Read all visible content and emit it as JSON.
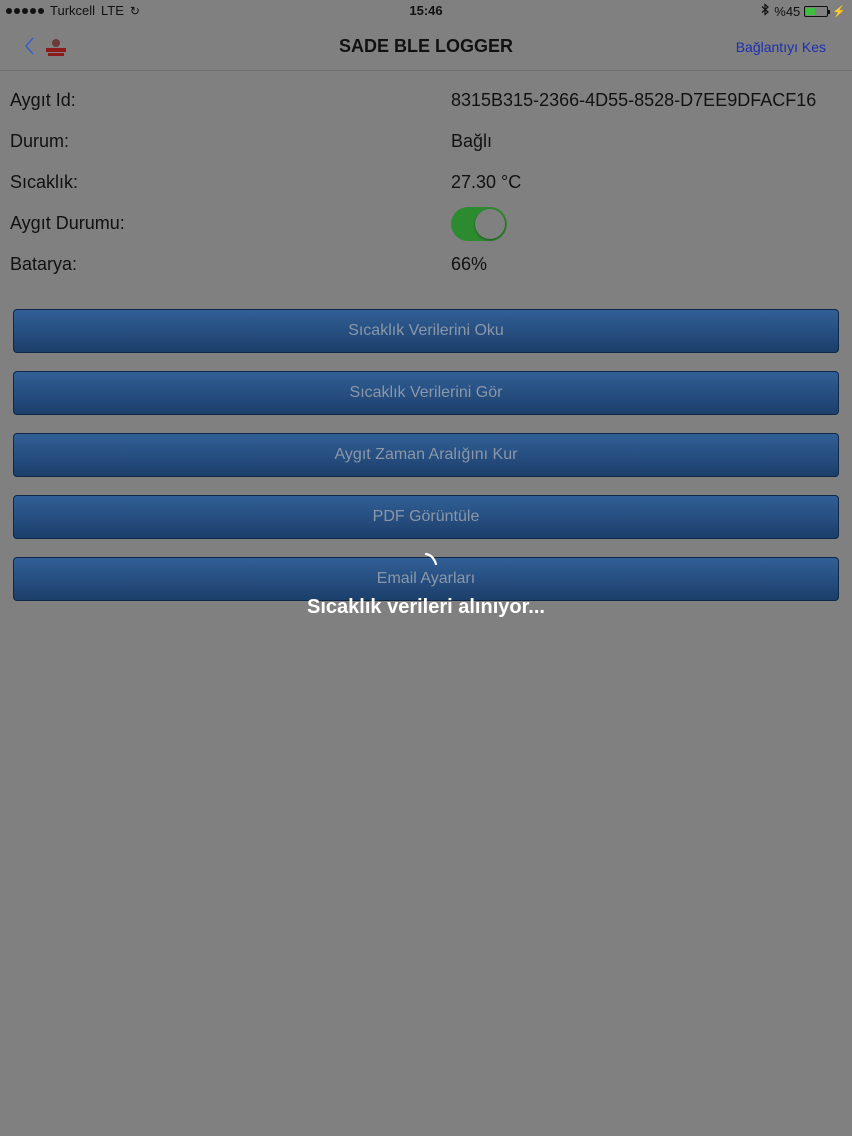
{
  "status_bar": {
    "carrier": "Turkcell",
    "network": "LTE",
    "time": "15:46",
    "battery_percent": "%45",
    "battery_level": 0.45,
    "icons": [
      "signal-dots-icon",
      "sync-icon",
      "bluetooth-icon",
      "battery-icon",
      "charging-bolt-icon"
    ]
  },
  "nav": {
    "title": "SADE BLE LOGGER",
    "back_icon": "chevron-left-icon",
    "disconnect_label": "Bağlantıyı Kes",
    "link_color": "#1b2fb0"
  },
  "device": {
    "id_label": "Aygıt Id:",
    "id_value": "8315B315-2366-4D55-8528-D7EE9DFACF16",
    "status_label": "Durum:",
    "status_value": "Bağlı",
    "temp_label": "Sıcaklık:",
    "temp_value": "27.30 °C",
    "device_state_label": "Aygıt Durumu:",
    "device_state_on": true,
    "battery_label": "Batarya:",
    "battery_value": "66%"
  },
  "actions": {
    "read_temps": "Sıcaklık Verilerini Oku",
    "view_temps": "Sıcaklık Verilerini Gör",
    "set_interval": "Aygıt Zaman Aralığını Kur",
    "view_pdf": "PDF Görüntüle",
    "email_settings": "Email Ayarları"
  },
  "loading": {
    "text": "Sıcaklık verileri alınıyor..."
  },
  "colors": {
    "toggle_on": "#2c8a2f",
    "button_top": "#315f96",
    "button_bottom": "#1c3f6b",
    "overlay_background": "#808080"
  }
}
